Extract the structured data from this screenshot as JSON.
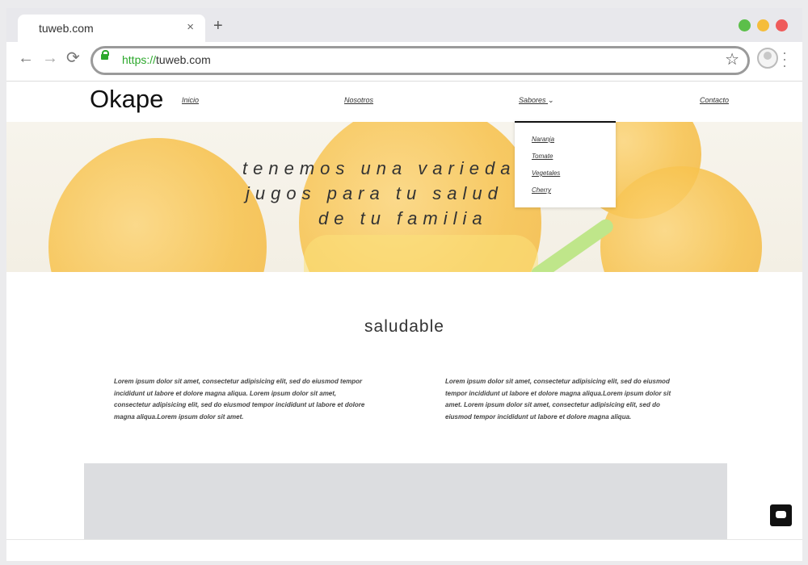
{
  "browser": {
    "tab_title": "tuweb.com",
    "tab_close": "×",
    "new_tab": "+",
    "url_scheme": "https://",
    "url_host": "tuweb.com",
    "traffic_lights": [
      "#5cbf4a",
      "#f5bd3b",
      "#ef5b5b"
    ]
  },
  "site": {
    "logo": "Okape",
    "nav": {
      "inicio": "Inicio",
      "nosotros": "Nosotros",
      "sabores": "Sabores",
      "contacto": "Contacto"
    },
    "dropdown": [
      "Naranja",
      "Tomate",
      "Vegetales",
      "Cherry"
    ],
    "hero_lines": [
      "tenemos una varieda",
      "jugos para tu salud",
      "de tu familia"
    ],
    "section_title": "saludable",
    "paragraph_left": "Lorem ipsum dolor sit amet, consectetur adipisicing elit, sed do eiusmod tempor incididunt ut labore et dolore magna aliqua. Lorem ipsum dolor sit amet, consectetur adipisicing elit, sed do eiusmod tempor incididunt ut labore et dolore magna aliqua.Lorem ipsum dolor sit amet.",
    "paragraph_right": "Lorem ipsum dolor sit amet, consectetur adipisicing elit, sed do eiusmod tempor incididunt ut labore et dolore magna aliqua.Lorem ipsum dolor sit amet. Lorem ipsum dolor sit amet, consectetur adipisicing elit, sed do eiusmod tempor incididunt ut labore et dolore magna aliqua."
  }
}
